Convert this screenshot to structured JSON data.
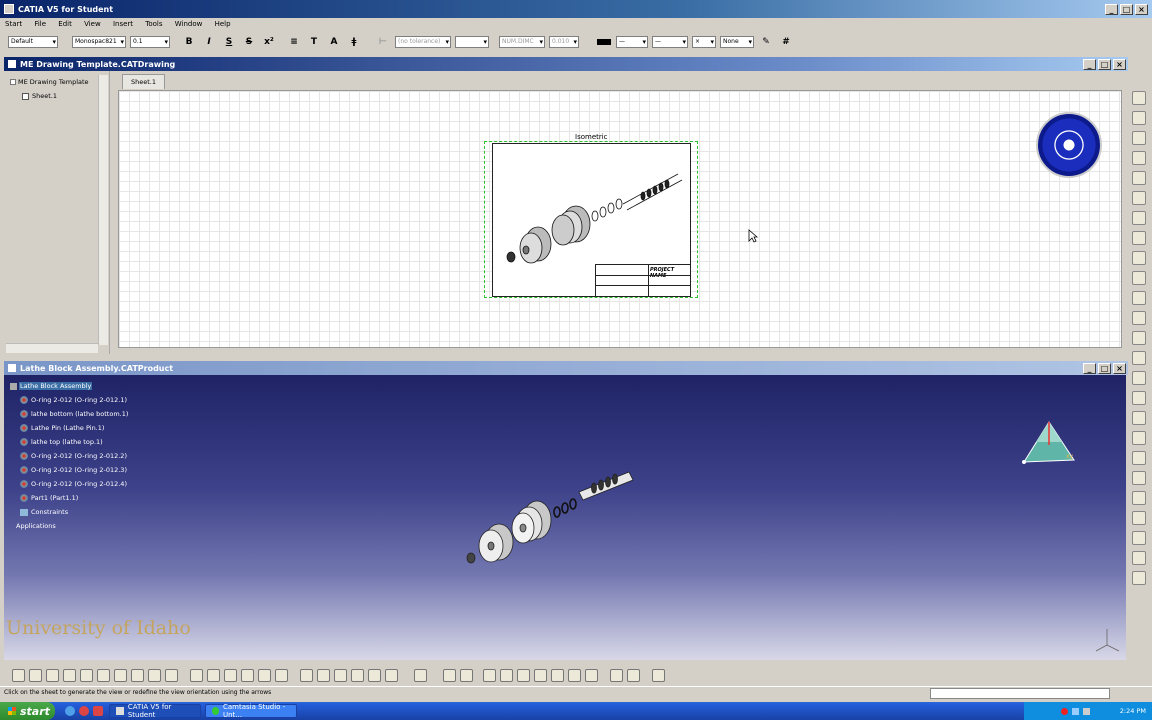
{
  "app": {
    "title": "CATIA V5 for Student",
    "menu": [
      "Start",
      "File",
      "Edit",
      "View",
      "Insert",
      "Tools",
      "Window",
      "Help"
    ]
  },
  "toolbar": {
    "style_value": "Default",
    "font_value": "Monospac821",
    "size_value": "0.1",
    "tolerance_value": "(no tolerance)",
    "num_value": "NUM.DIMC",
    "precision_value": "0.010",
    "bold_label": "B",
    "italic_label": "I",
    "underline_label": "S",
    "strike_label": "S",
    "line_value": "None"
  },
  "drawing_window": {
    "title": "ME Drawing Template.CATDrawing",
    "tree": [
      "ME Drawing Template",
      "Sheet.1"
    ],
    "sheet_tab": "Sheet.1",
    "view_label": "Isometric",
    "title_block": "PROJECT NAME"
  },
  "product_window": {
    "title": "Lathe Block Assembly.CATProduct",
    "tree": [
      "Lathe Block Assembly",
      "O-ring 2-012 (O-ring 2-012.1)",
      "lathe bottom (lathe bottom.1)",
      "Lathe Pin (Lathe Pin.1)",
      "lathe top (lathe top.1)",
      "O-ring 2-012 (O-ring 2-012.2)",
      "O-ring 2-012 (O-ring 2-012.3)",
      "O-ring 2-012 (O-ring 2-012.4)",
      "Part1 (Part1.1)",
      "Constraints",
      "Applications"
    ],
    "watermark": "University of Idaho"
  },
  "status_bar": {
    "message": "Click on the sheet to generate the view or redefine the view orientation using the arrows"
  },
  "taskbar": {
    "start": "start",
    "items": [
      "CATIA V5 for Student",
      "Camtasia Studio - Unt..."
    ],
    "clock": "2:24 PM"
  },
  "colors": {
    "title_bar": "#0a246a",
    "product_bg_top": "#6b6fb0",
    "product_bg_bottom": "#d6d6e8",
    "selection": "#3a6ea5",
    "compass": "#1a2dbd",
    "watermark": "#c8a24a"
  }
}
